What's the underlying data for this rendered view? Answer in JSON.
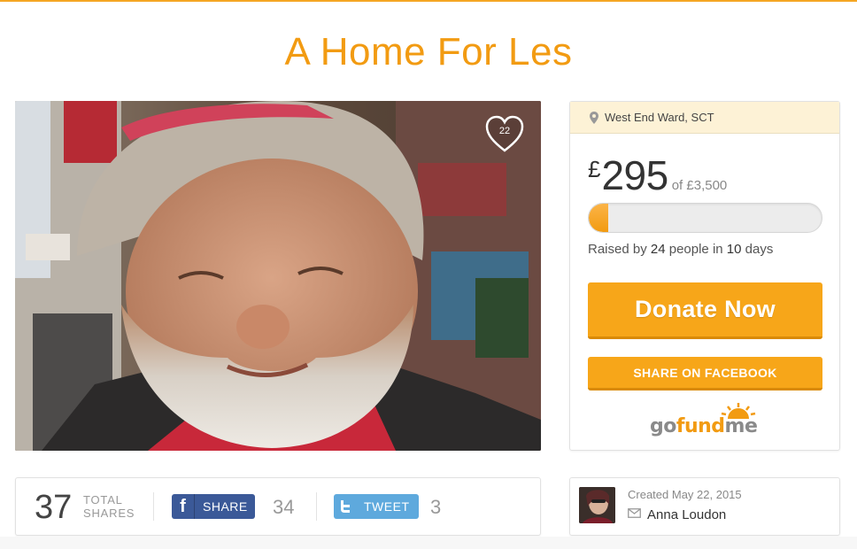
{
  "campaign": {
    "title": "A Home For Les",
    "hearts": "22",
    "location": "West End Ward, SCT"
  },
  "donation": {
    "currency": "£",
    "raised": "295",
    "goal_text": "of £3,500",
    "progress_fraction": 0.084,
    "raised_prefix": "Raised by",
    "people": "24",
    "people_label": "people in",
    "days": "10",
    "days_label": "days",
    "donate_label": "Donate Now",
    "facebook_label": "SHARE ON FACEBOOK"
  },
  "brand": {
    "logo_go": "go",
    "logo_fund": "fund",
    "logo_me": "me",
    "accent": "#f29b12"
  },
  "shares": {
    "total": "37",
    "total_label_1": "TOTAL",
    "total_label_2": "SHARES",
    "fb_label": "SHARE",
    "fb_count": "34",
    "tw_label": "TWEET",
    "tw_count": "3"
  },
  "organizer": {
    "created": "Created May 22, 2015",
    "name": "Anna Loudon"
  },
  "icons": [
    "location-pin-icon",
    "heart-icon",
    "facebook-icon",
    "twitter-icon",
    "mail-icon",
    "sun-icon"
  ]
}
